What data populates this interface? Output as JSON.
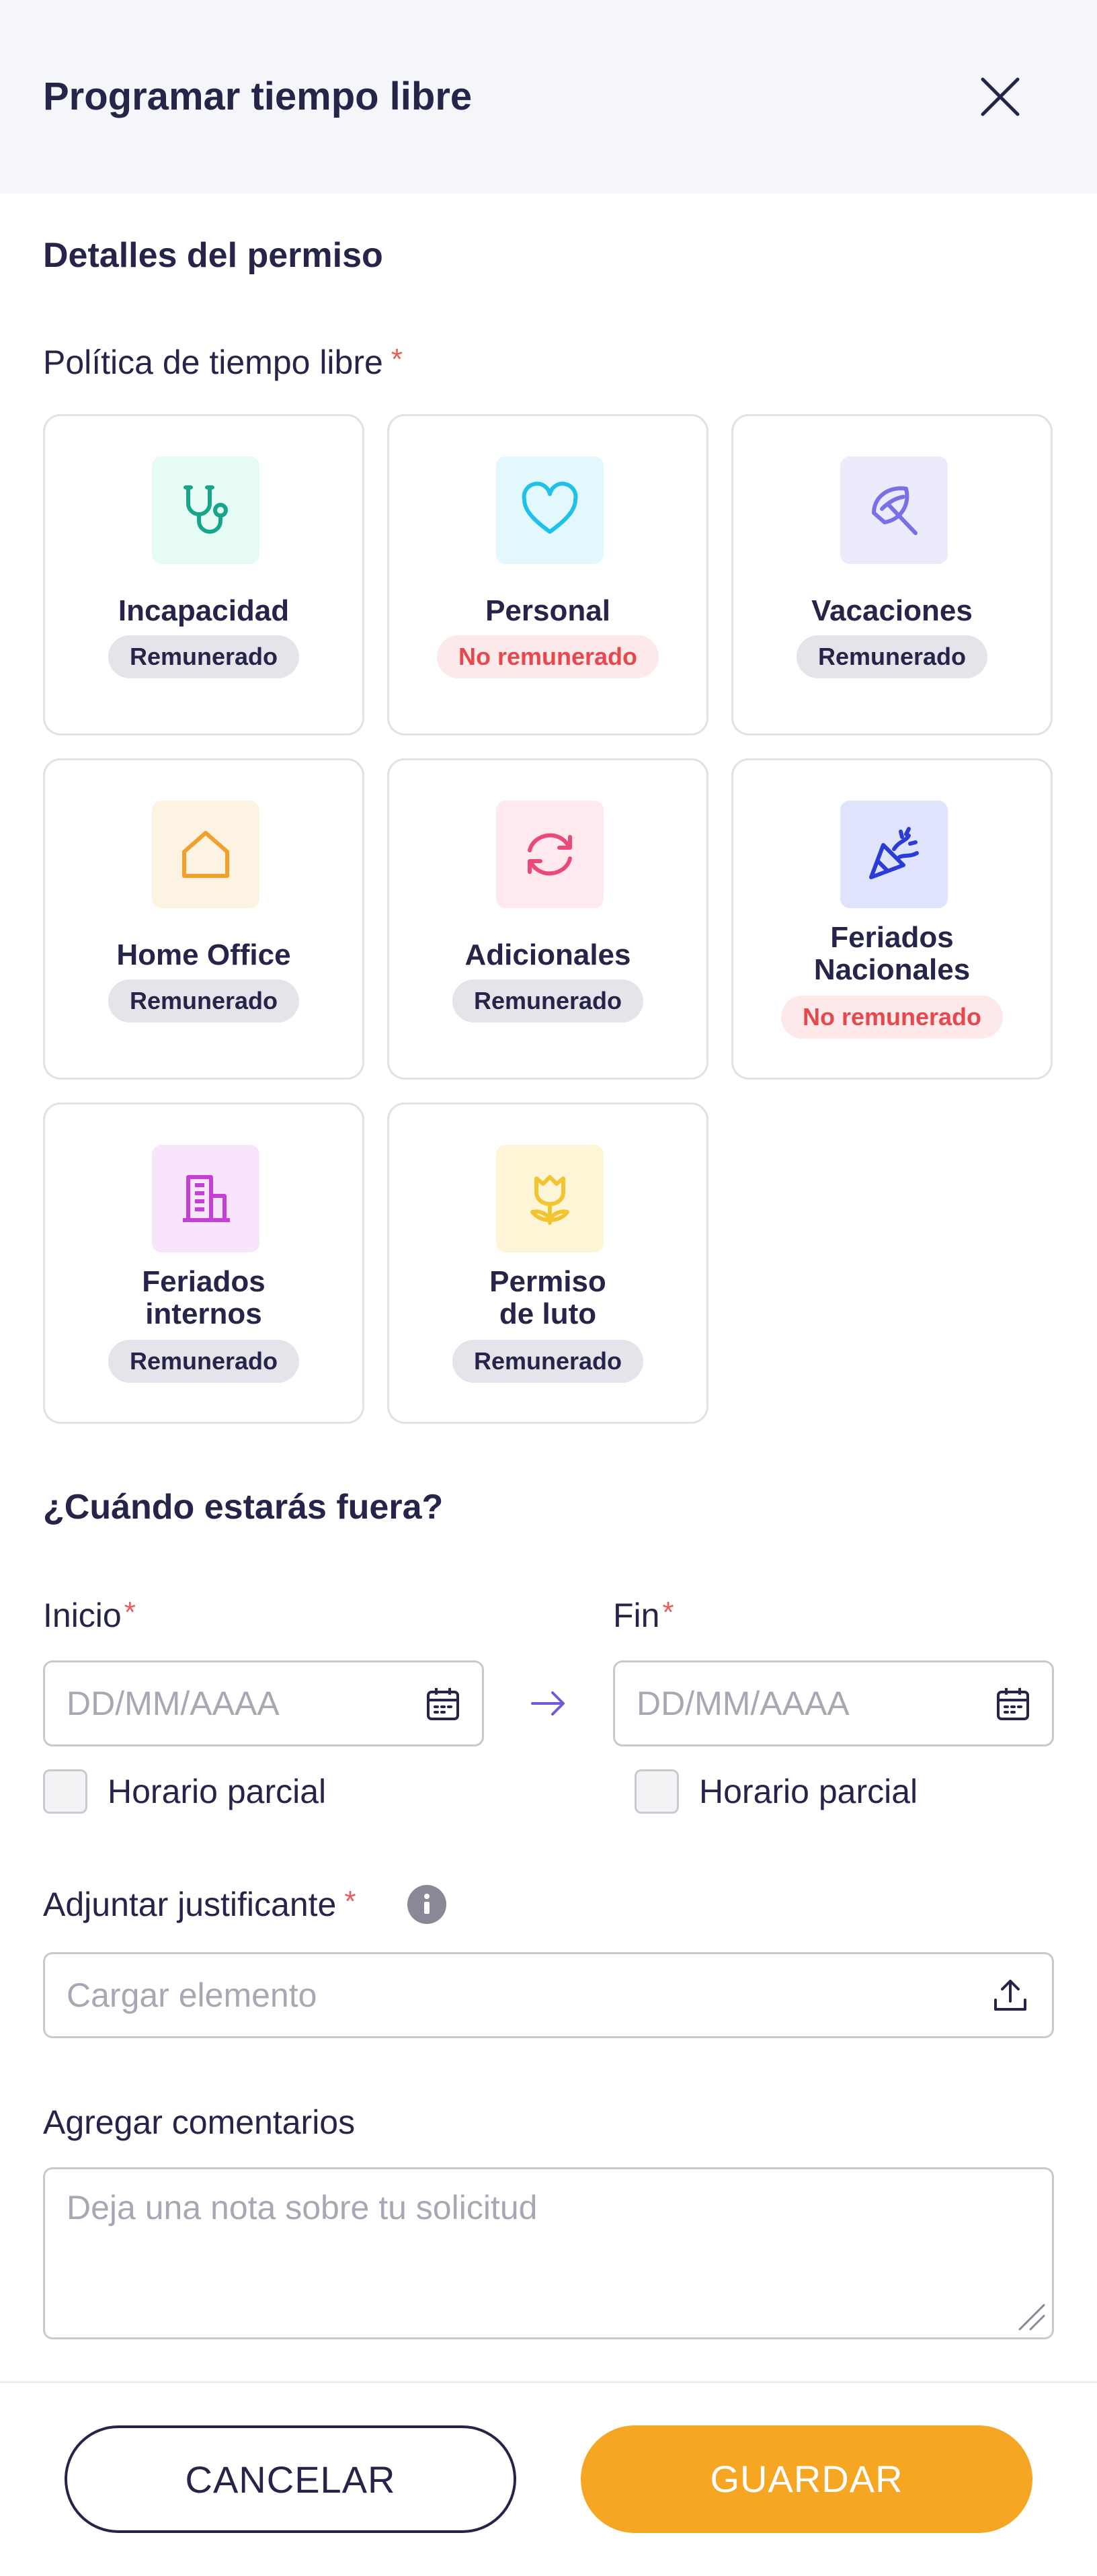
{
  "header": {
    "title": "Programar tiempo libre",
    "close_icon": "close-icon"
  },
  "details": {
    "title": "Detalles del permiso",
    "policy_label": "Política de tiempo libre",
    "required_mark": "*"
  },
  "policies": [
    {
      "name": "Incapacidad",
      "badge": "Remunerado",
      "paid": true,
      "icon": "stethoscope-icon",
      "icon_bg": "#e6faf6",
      "icon_color": "#17a689"
    },
    {
      "name": "Personal",
      "badge": "No remunerado",
      "paid": false,
      "icon": "heart-icon",
      "icon_bg": "#e3f8fc",
      "icon_color": "#1fc1e8"
    },
    {
      "name": "Vacaciones",
      "badge": "Remunerado",
      "paid": true,
      "icon": "umbrella-icon",
      "icon_bg": "#ecebfb",
      "icon_color": "#7a70e6"
    },
    {
      "name": "Home Office",
      "badge": "Remunerado",
      "paid": true,
      "icon": "house-icon",
      "icon_bg": "#fdf3e3",
      "icon_color": "#f2a02c"
    },
    {
      "name": "Adicionales",
      "badge": "Remunerado",
      "paid": true,
      "icon": "refresh-icon",
      "icon_bg": "#fde9ee",
      "icon_color": "#e94a7a"
    },
    {
      "name_line1": "Feriados",
      "name_line2": "Nacionales",
      "badge": "No remunerado",
      "paid": false,
      "icon": "party-popper-icon",
      "icon_bg": "#dfe3fb",
      "icon_color": "#2a3bd6"
    },
    {
      "name_line1": "Feriados",
      "name_line2": "internos",
      "badge": "Remunerado",
      "paid": true,
      "icon": "building-icon",
      "icon_bg": "#f8e4fb",
      "icon_color": "#c53fd6"
    },
    {
      "name_line1": "Permiso",
      "name_line2": "de luto",
      "badge": "Remunerado",
      "paid": true,
      "icon": "tulip-icon",
      "icon_bg": "#fdf5d6",
      "icon_color": "#f2c431"
    }
  ],
  "when": {
    "title": "¿Cuándo estarás fuera?",
    "start_label": "Inicio",
    "end_label": "Fin",
    "start_placeholder": "DD/MM/AAAA",
    "end_placeholder": "DD/MM/AAAA",
    "partial_start": "Horario parcial",
    "partial_end": "Horario parcial"
  },
  "attachment": {
    "label": "Adjuntar justificante",
    "placeholder": "Cargar elemento"
  },
  "comments": {
    "label": "Agregar comentarios",
    "placeholder": "Deja una nota sobre tu solicitud"
  },
  "actions": {
    "cancel": "CANCELAR",
    "save": "GUARDAR"
  },
  "colors": {
    "primary": "#262449",
    "accent": "#f5a623",
    "required": "#e85d5d",
    "unpaid": "#e5484d"
  }
}
